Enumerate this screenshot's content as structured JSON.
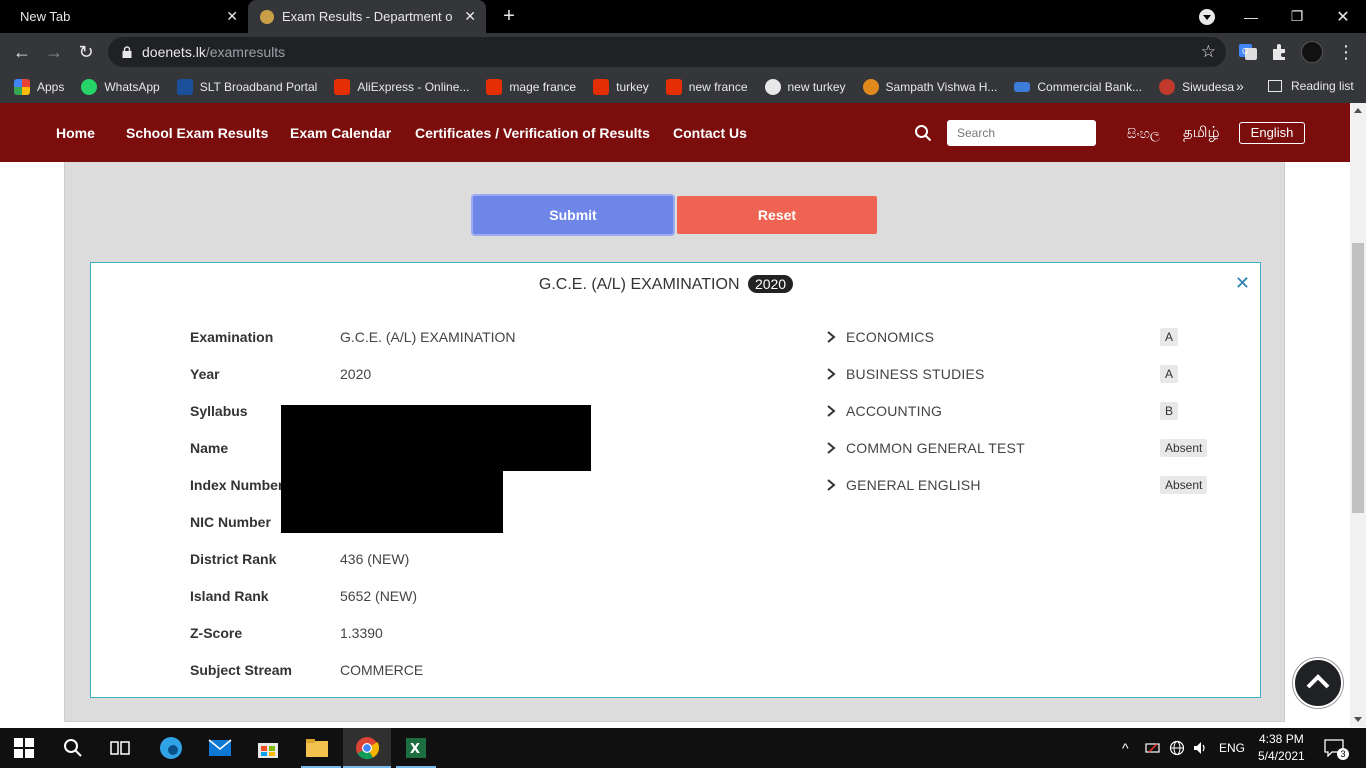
{
  "browser": {
    "tabs": [
      {
        "title": "New Tab",
        "active": false
      },
      {
        "title": "Exam Results - Department of Examinations",
        "active": true
      }
    ],
    "url_host": "doenets.lk",
    "url_path": "/examresults",
    "bookmarks": [
      {
        "label": "Apps",
        "icon": "apps-grid-icon",
        "color": "#f5a623"
      },
      {
        "label": "WhatsApp",
        "icon": "whatsapp-icon",
        "color": "#25d366"
      },
      {
        "label": "SLT Broadband Portal",
        "icon": "slt-icon",
        "color": "#1a73e8"
      },
      {
        "label": "AliExpress - Online...",
        "icon": "aliexpress-icon",
        "color": "#e62e04"
      },
      {
        "label": "mage france",
        "icon": "aliexpress-icon",
        "color": "#e62e04"
      },
      {
        "label": "turkey",
        "icon": "aliexpress-icon",
        "color": "#e62e04"
      },
      {
        "label": "new france",
        "icon": "aliexpress-icon",
        "color": "#e62e04"
      },
      {
        "label": "new turkey",
        "icon": "globe-icon",
        "color": "#e8e8e8"
      },
      {
        "label": "Sampath Vishwa H...",
        "icon": "sampath-icon",
        "color": "#e08a1e"
      },
      {
        "label": "Commercial Bank...",
        "icon": "combank-icon",
        "color": "#3b7dd8"
      },
      {
        "label": "Siwudesa",
        "icon": "siwudesa-icon",
        "color": "#c0392b"
      }
    ],
    "reading_list": "Reading list"
  },
  "site": {
    "nav": [
      "Home",
      "School Exam Results",
      "Exam Calendar",
      "Certificates / Verification of Results",
      "Contact Us"
    ],
    "search_placeholder": "Search",
    "lang_si": "සිංහල",
    "lang_ta": "தமிழ்",
    "lang_en": "English",
    "submit_label": "Submit",
    "reset_label": "Reset"
  },
  "result": {
    "title": "G.C.E. (A/L) EXAMINATION",
    "year_badge": "2020",
    "fields": [
      {
        "label": "Examination",
        "value": "G.C.E. (A/L) EXAMINATION"
      },
      {
        "label": "Year",
        "value": "2020"
      },
      {
        "label": "Syllabus",
        "value": ""
      },
      {
        "label": "Name",
        "value": ""
      },
      {
        "label": "Index Number",
        "value": ""
      },
      {
        "label": "NIC Number",
        "value": ""
      },
      {
        "label": "District Rank",
        "value": "436 (NEW)"
      },
      {
        "label": "Island Rank",
        "value": "5652 (NEW)"
      },
      {
        "label": "Z-Score",
        "value": "1.3390"
      },
      {
        "label": "Subject Stream",
        "value": "COMMERCE"
      }
    ],
    "subjects": [
      {
        "name": "ECONOMICS",
        "grade": "A"
      },
      {
        "name": "BUSINESS STUDIES",
        "grade": "A"
      },
      {
        "name": "ACCOUNTING",
        "grade": "B"
      },
      {
        "name": "COMMON GENERAL TEST",
        "grade": "Absent"
      },
      {
        "name": "GENERAL ENGLISH",
        "grade": "Absent"
      }
    ]
  },
  "taskbar": {
    "lang": "ENG",
    "time": "4:38 PM",
    "date": "5/4/2021",
    "notifications": "3"
  }
}
